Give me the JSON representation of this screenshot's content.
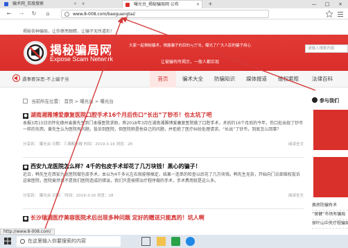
{
  "browser": {
    "tabs": [
      {
        "label": "骗术网_百度搜索",
        "active": false
      },
      {
        "label": "曝光台_揭秘骗局网 公布",
        "active": true
      }
    ],
    "tab_close": "×",
    "new_tab": "+",
    "tab_dropdown": "∨",
    "window_controls": [
      "—",
      "□",
      "×"
    ],
    "nav": {
      "back": "←",
      "forward": "→",
      "refresh": "↻",
      "home": "⌂"
    },
    "url": "www.8-008.com/baoguangtai/",
    "status_link": "http://www.8-008.com/"
  },
  "site": {
    "top_text": "揭秘各种骗局，让你擦亮眼睛，让骗子无所遁形！",
    "logo_title": "揭秘骗局网",
    "logo_subtitle": "Expose Scam Network",
    "slogan": "大家一起揭秘骗术，揭露骗子的目的与方法，曝光了广大人民的骗子用心",
    "slogan2": "让被骗有所揭示，一般人都实现",
    "search_placeholder": "请输入搜索内容",
    "report": "遇事要深思-不上骗子当",
    "nav": [
      {
        "label": "首页",
        "active": true
      },
      {
        "label": "骗术大全",
        "active": false
      },
      {
        "label": "防骗知识",
        "active": false
      },
      {
        "label": "媒体报道",
        "active": false
      },
      {
        "label": "维权索赔",
        "active": false
      },
      {
        "label": "法律百科",
        "active": false
      }
    ],
    "breadcrumb": [
      "当前所在位置：",
      "首页",
      ">",
      "曝光台",
      ">",
      "曝光台"
    ]
  },
  "articles": [
    {
      "title": "湖南湘雅博爱康复医院口腔手术16个月后伤口“长出”了钞币！也太坑了吧",
      "body": "本报3月15日讯怀化德州省黄先生到门本报医院求助，称2018年3月在湖南湘雅博爱康复医院做了口腔手术，术后约16个月后的今年，伤口处出现了钞币一样的东西，黄先生认为医院有问题，投诉到医院，但医院称是他自己的问题，并拒绝了医疗纠纷处理请求。“长出”了钞币，到底怎么回事？",
      "meta": "分享到：  曝光台  日期：三湘都市报  时间：2019-3-16  浏览：28",
      "more": "阅读全文"
    },
    {
      "title": "西安九龙医院怎么样？4千的包皮手术却花了几万块钱！黑心的骗子！",
      "body": "近日，韩先生在西安九龙医院做包皮手术，本以为4千多元左右就能够搞定，结果一连串的检查以后花了几万块钱。韩先生无奈，开始向门诊部维权投诉这家医院，医院竟然说不是我们医院造成的错误，我们只是按照治疗程序做的手术，手术费用就是这么多。",
      "meta": "分享到：  曝光台  日期：  时间：2019-3-16  浏览：28",
      "more": "阅读全文"
    },
    {
      "title": "长沙瑞湘医疗美容医院术后出现多种问题 定好的赠送只能真的！坑人啊",
      "body": "",
      "meta": "",
      "more": ""
    }
  ],
  "sidebar": {
    "head": "参与我们",
    "list": [
      "换房防骗有术",
      "“保健”市场有骗局",
      "探叶山中央疗程骗局"
    ]
  },
  "taskbar": {
    "search_placeholder": "在这里输入你要搜索的内容"
  },
  "colors": {
    "brand_red": "#d92e2b",
    "annotation_red": "#d43a3a"
  }
}
